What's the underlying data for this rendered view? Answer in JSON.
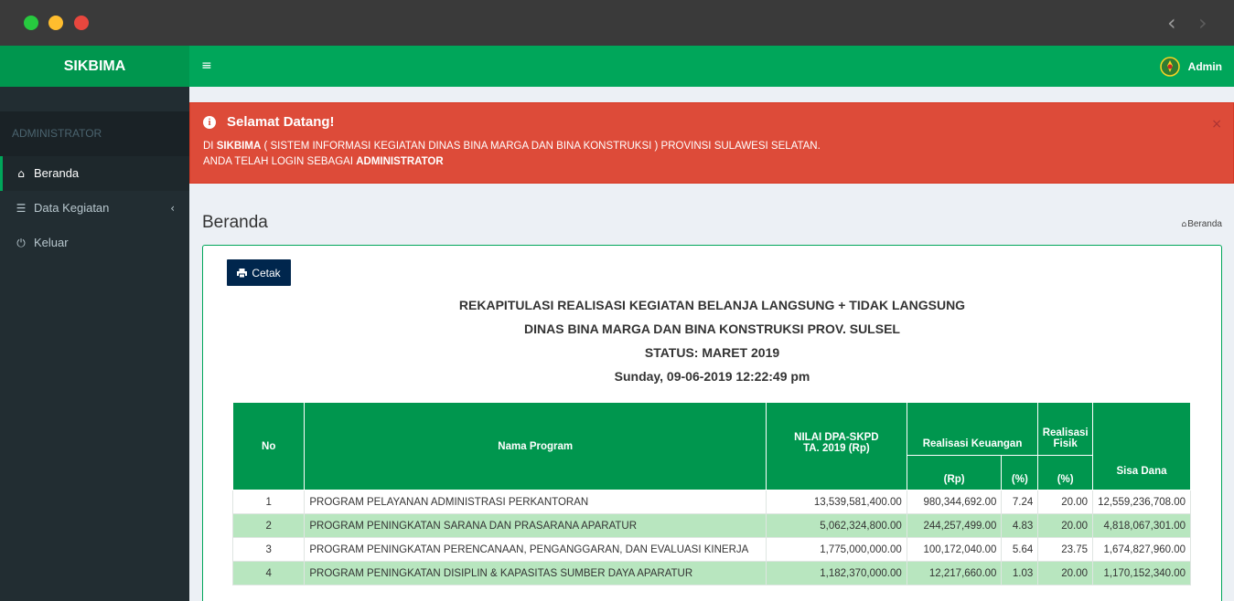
{
  "app": {
    "name": "SIKBIMA",
    "user": "Admin"
  },
  "sidebar": {
    "header": "ADMINISTRATOR",
    "items": [
      {
        "label": "Beranda",
        "icon": "home-icon",
        "active": true
      },
      {
        "label": "Data Kegiatan",
        "icon": "table-icon",
        "has_submenu": true
      },
      {
        "label": "Keluar",
        "icon": "power-icon"
      }
    ]
  },
  "alert": {
    "title": "Selamat Datang!",
    "line1_prefix": "DI ",
    "line1_bold": "SIKBIMA",
    "line1_rest": " ( SISTEM INFORMASI KEGIATAN DINAS BINA MARGA DAN BINA KONSTRUKSI ) PROVINSI SULAWESI SELATAN.",
    "line2_prefix": "ANDA TELAH LOGIN SEBAGAI ",
    "line2_bold": "ADMINISTRATOR",
    "close": "×"
  },
  "page": {
    "title": "Beranda",
    "breadcrumb": "Beranda"
  },
  "print_button": "Cetak",
  "report": {
    "title1": "REKAPITULASI REALISASI KEGIATAN BELANJA LANGSUNG + TIDAK LANGSUNG",
    "title2": "DINAS BINA MARGA DAN BINA KONSTRUKSI PROV. SULSEL",
    "title3": "STATUS: MARET 2019",
    "title4": "Sunday, 09-06-2019 12:22:49 pm"
  },
  "table": {
    "headers": {
      "no": "No",
      "nama": "Nama Program",
      "nilai_line1": "NILAI DPA-SKPD",
      "nilai_line2": "TA. 2019 (Rp)",
      "realisasi_keuangan": "Realisasi Keuangan",
      "realisasi_fisik_line1": "Realisasi",
      "realisasi_fisik_line2": "Fisik",
      "rp": "(Rp)",
      "pct_keu": "(%)",
      "pct_fis": "(%)",
      "sisa": "Sisa Dana"
    },
    "rows": [
      {
        "no": "1",
        "nama": "PROGRAM PELAYANAN ADMINISTRASI PERKANTORAN",
        "nilai": "13,539,581,400.00",
        "rp": "980,344,692.00",
        "pct_keu": "7.24",
        "pct_fis": "20.00",
        "sisa": "12,559,236,708.00"
      },
      {
        "no": "2",
        "nama": "PROGRAM PENINGKATAN SARANA DAN PRASARANA APARATUR",
        "nilai": "5,062,324,800.00",
        "rp": "244,257,499.00",
        "pct_keu": "4.83",
        "pct_fis": "20.00",
        "sisa": "4,818,067,301.00"
      },
      {
        "no": "3",
        "nama": "PROGRAM PENINGKATAN PERENCANAAN, PENGANGGARAN, DAN EVALUASI KINERJA",
        "nilai": "1,775,000,000.00",
        "rp": "100,172,040.00",
        "pct_keu": "5.64",
        "pct_fis": "23.75",
        "sisa": "1,674,827,960.00"
      },
      {
        "no": "4",
        "nama": "PROGRAM PENINGKATAN DISIPLIN & KAPASITAS SUMBER DAYA APARATUR",
        "nilai": "1,182,370,000.00",
        "rp": "12,217,660.00",
        "pct_keu": "1.03",
        "pct_fis": "20.00",
        "sisa": "1,170,152,340.00"
      }
    ]
  },
  "colors": {
    "brand_green": "#00a65a",
    "header_dark_green": "#00964e",
    "sidebar_bg": "#222d32",
    "alert_red": "#dd4b39",
    "row_alt": "#b8e6bf",
    "button_navy": "#00264d"
  }
}
